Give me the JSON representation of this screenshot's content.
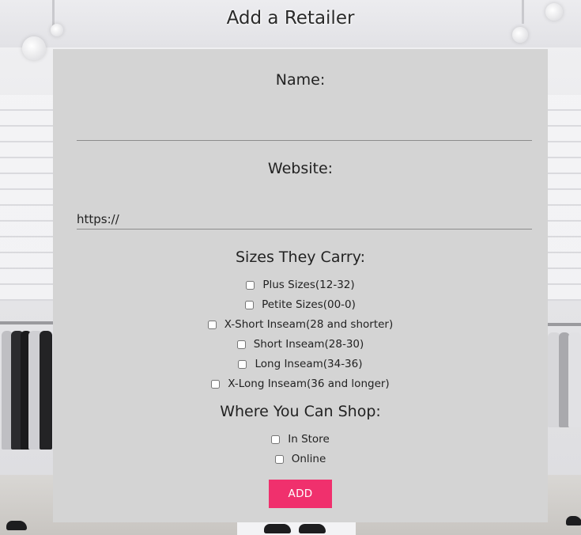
{
  "page": {
    "title": "Add a Retailer"
  },
  "form": {
    "name_label": "Name:",
    "name_value": "",
    "website_label": "Website:",
    "website_value": "https://",
    "sizes_title": "Sizes They Carry:",
    "sizes": [
      {
        "label": "Plus Sizes(12-32)",
        "checked": false
      },
      {
        "label": "Petite Sizes(00-0)",
        "checked": false
      },
      {
        "label": "X-Short Inseam(28 and shorter)",
        "checked": false
      },
      {
        "label": "Short Inseam(28-30)",
        "checked": false
      },
      {
        "label": "Long Inseam(34-36)",
        "checked": false
      },
      {
        "label": "X-Long Inseam(36 and longer)",
        "checked": false
      }
    ],
    "shop_title": "Where You Can Shop:",
    "shop_options": [
      {
        "label": "In Store",
        "checked": false
      },
      {
        "label": "Online",
        "checked": false
      }
    ],
    "submit_label": "ADD"
  },
  "colors": {
    "panel_bg": "#d4d4d4",
    "button_bg": "#f0306d",
    "button_text": "#ffffff",
    "underline": "#8c8c8c"
  }
}
